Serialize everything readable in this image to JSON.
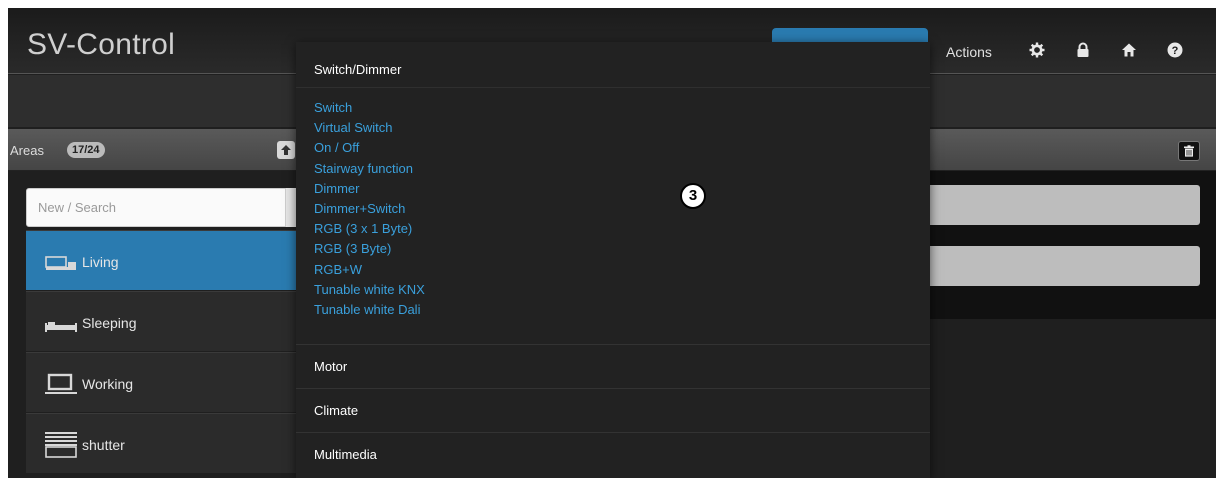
{
  "app": {
    "title": "SV-Control"
  },
  "navbar": {
    "actions_label": "Actions",
    "icons": [
      "gear-icon",
      "lock-icon",
      "home-icon",
      "help-icon"
    ]
  },
  "areas": {
    "title": "Areas",
    "count": "17/24",
    "search_placeholder": "New / Search",
    "items": [
      {
        "label": "Living",
        "icon": "sofa-icon",
        "active": true
      },
      {
        "label": "Sleeping",
        "icon": "bed-icon",
        "active": false
      },
      {
        "label": "Working",
        "icon": "monitor-icon",
        "active": false
      },
      {
        "label": "shutter",
        "icon": "shutter-icon",
        "active": false
      }
    ]
  },
  "dropdown": {
    "header": "Switch/Dimmer",
    "items": [
      "Switch",
      "Virtual Switch",
      "On / Off",
      "Stairway function",
      "Dimmer",
      "Dimmer+Switch",
      "RGB (3 x 1 Byte)",
      "RGB (3 Byte)",
      "RGB+W",
      "Tunable white KNX",
      "Tunable white Dali"
    ],
    "sections": [
      "Motor",
      "Climate",
      "Multimedia"
    ]
  },
  "step_marker": "3",
  "colors": {
    "accent": "#2a7bb0",
    "link": "#3aa0dc",
    "background": "#1f1f1f"
  }
}
